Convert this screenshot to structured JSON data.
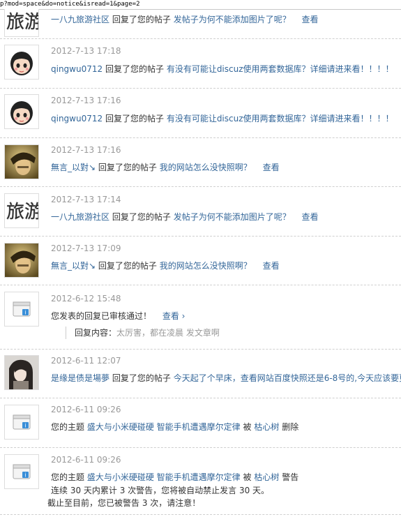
{
  "url": "p?mod=space&do=notice&isread=1&page=2",
  "verb_replied": "回复了您的帖子",
  "view_label": "查看",
  "view_label_arrow": "查看 ›",
  "notices": [
    {
      "avatar": "travel-logo",
      "time": "",
      "user": "一八九旅游社区",
      "subject": "发帖子为何不能添加图片了呢？"
    },
    {
      "avatar": "cartoon-girl",
      "time": "2012-7-13 17:18",
      "user": "qingwu0712",
      "subject": "有没有可能让discuz使用两套数据库？详细请进来看！！！！"
    },
    {
      "avatar": "cartoon-girl",
      "time": "2012-7-13 17:16",
      "user": "qingwu0712",
      "subject": "有没有可能让discuz使用两套数据库？详细请进来看！！！！"
    },
    {
      "avatar": "photo-boy",
      "time": "2012-7-13 17:16",
      "user": "無言_以對↘",
      "subject": "我的网站怎么没快照啊？"
    },
    {
      "avatar": "travel-logo",
      "time": "2012-7-13 17:14",
      "user": "一八九旅游社区",
      "subject": "发帖子为何不能添加图片了呢？"
    },
    {
      "avatar": "photo-boy",
      "time": "2012-7-13 17:09",
      "user": "無言_以對↘",
      "subject": "我的网站怎么没快照啊？"
    }
  ],
  "system_notice_1": {
    "time": "2012-6-12 15:48",
    "text": "您发表的回复已审核通过！",
    "quote_label": "回复内容：",
    "quote_text": "太厉害，都在凌晨 发文章啊"
  },
  "notice_girl": {
    "time": "2012-6-11 12:07",
    "user": "是缘是债是場夢",
    "subject": "今天起了个早床，查看网站百度快照还是6-8号的,今天应该要更"
  },
  "system_notice_2": {
    "time": "2012-6-11 09:26",
    "prefix": "您的主题",
    "topic": "盛大与小米硬碰硬 智能手机遭遇摩尔定律",
    "by": "被",
    "user": "枯心树",
    "action": "删除"
  },
  "system_notice_3": {
    "time": "2012-6-11 09:26",
    "prefix": "您的主题",
    "topic": "盛大与小米硬碰硬 智能手机遭遇摩尔定律",
    "by": "被",
    "user": "枯心树",
    "action": "警告",
    "line2": "连续 30 天内累计 3 次警告，您将被自动禁止发言 30 天。",
    "line3": "截止至目前，您已被警告 3 次，请注意！"
  }
}
